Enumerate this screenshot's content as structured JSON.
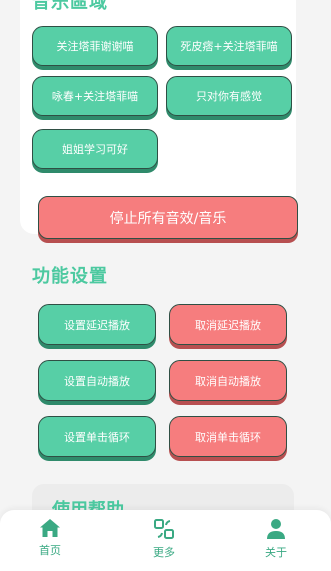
{
  "music_section": {
    "title": "音乐區域",
    "buttons": [
      {
        "label": "关注塔菲谢谢喵"
      },
      {
        "label": "死皮痞+关注塔菲喵"
      },
      {
        "label": "咏春+关注塔菲喵"
      },
      {
        "label": "只对你有感觉"
      },
      {
        "label": "姐姐学习可好"
      }
    ],
    "stop_label": "停止所有音效/音乐"
  },
  "settings_section": {
    "title": "功能设置",
    "rows": [
      {
        "set": "设置延迟播放",
        "cancel": "取消延迟播放"
      },
      {
        "set": "设置自动播放",
        "cancel": "取消自动播放"
      },
      {
        "set": "设置单击循环",
        "cancel": "取消单击循环"
      }
    ]
  },
  "help_section": {
    "title": "使用帮助"
  },
  "tabbar": {
    "items": [
      {
        "label": "首页",
        "icon": "home-icon"
      },
      {
        "label": "更多",
        "icon": "more-icon"
      },
      {
        "label": "关于",
        "icon": "person-icon"
      }
    ]
  },
  "colors": {
    "accent": "#4cc9a0",
    "green_button": "#57cfa6",
    "red_button": "#f67d7e"
  }
}
